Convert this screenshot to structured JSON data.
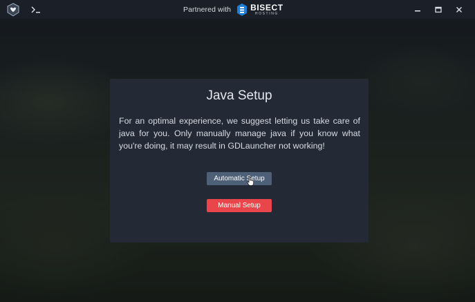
{
  "titlebar": {
    "partner_text": "Partnered with",
    "partner_brand": "BISECT",
    "partner_brand_sub": "HOSTING",
    "icons": {
      "app_logo": "gdlauncher-logo-icon",
      "terminal": "terminal-icon",
      "minimize": "minimize-icon",
      "maximize": "maximize-icon",
      "close": "close-icon",
      "brand_logo": "bisect-hosting-logo-icon"
    }
  },
  "dialog": {
    "title": "Java Setup",
    "message": "For an optimal experience, we suggest letting us take care of java for you. Only manually manage java if you know what you're doing, it may result in GDLauncher not working!",
    "automatic_setup_label": "Automatic Setup",
    "manual_setup_label": "Manual Setup"
  },
  "colors": {
    "titlebar_bg": "#1b2028",
    "dialog_bg": "#232a35",
    "automatic_button": "#4e5f78",
    "manual_button": "#e8464b"
  }
}
